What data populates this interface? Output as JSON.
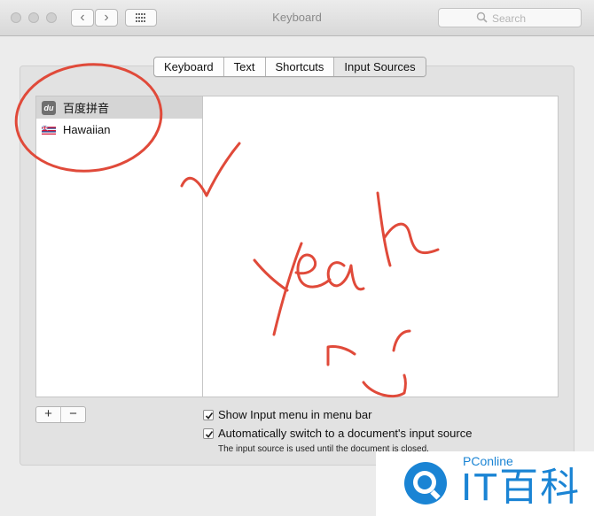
{
  "window": {
    "title": "Keyboard"
  },
  "toolbar": {
    "back_icon": "‹",
    "forward_icon": "›",
    "show_all_icon": "grid-icon"
  },
  "search": {
    "placeholder": "Search"
  },
  "tabs": [
    {
      "label": "Keyboard"
    },
    {
      "label": "Text"
    },
    {
      "label": "Shortcuts"
    },
    {
      "label": "Input Sources",
      "active": true
    }
  ],
  "input_sources": [
    {
      "label": "百度拼音",
      "icon": "du-icon",
      "icon_text": "du",
      "selected": true
    },
    {
      "label": "Hawaiian",
      "icon": "hawaiian-flag-icon"
    }
  ],
  "list_controls": {
    "add": "+",
    "remove": "−"
  },
  "options": {
    "show_menu": {
      "label": "Show Input menu in menu bar",
      "checked": true
    },
    "auto_switch": {
      "label": "Automatically switch to a document's input source",
      "checked": true
    },
    "note": "The input source is used until the document is closed."
  },
  "watermark": {
    "small": "PConline",
    "big": "IT百科"
  },
  "colors": {
    "annotation": "#e04a3a",
    "watermark": "#1a84d4"
  }
}
